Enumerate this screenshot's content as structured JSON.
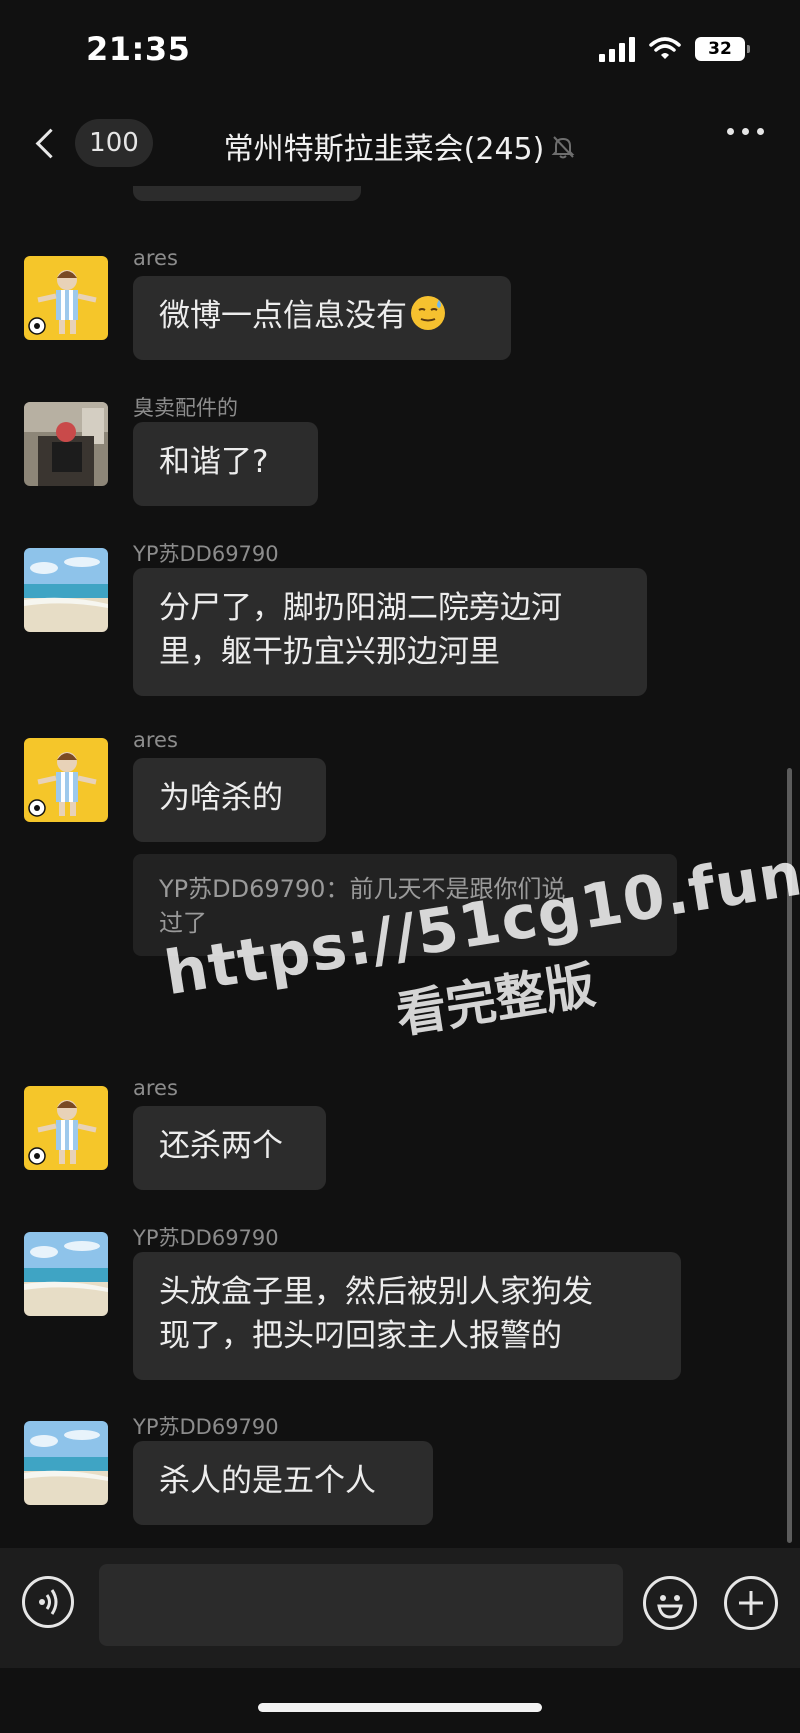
{
  "status_bar": {
    "time": "21:35",
    "battery": "32"
  },
  "nav": {
    "unread_count": "100",
    "title": "常州特斯拉韭菜会(245)"
  },
  "icons": {
    "back": "chevron-left-icon",
    "mute": "bell-slash-icon",
    "more": "more-dots-icon",
    "voice": "voice-icon",
    "emoji": "emoji-icon",
    "plus": "plus-icon"
  },
  "messages": [
    {
      "sender": "ares",
      "avatar": "avatar-cartoon-footballer",
      "text": "微博一点信息没有",
      "emoji": "sweat-smile-emoji"
    },
    {
      "sender": "臭卖配件的",
      "avatar": "avatar-room-photo",
      "text": "和谐了?"
    },
    {
      "sender": "YP苏DD69790",
      "avatar": "avatar-beach-photo",
      "text_lines": [
        "分尸了，脚扔阳湖二院旁边河",
        "里，躯干扔宜兴那边河里"
      ]
    },
    {
      "sender": "ares",
      "avatar": "avatar-cartoon-footballer",
      "text": "为啥杀的",
      "quote_lines": [
        "YP苏DD69790：前几天不是跟你们说",
        "过了"
      ]
    },
    {
      "sender": "ares",
      "avatar": "avatar-cartoon-footballer",
      "text": "还杀两个"
    },
    {
      "sender": "YP苏DD69790",
      "avatar": "avatar-beach-photo",
      "text_lines": [
        "头放盒子里，然后被别人家狗发",
        "现了，把头叼回家主人报警的"
      ]
    },
    {
      "sender": "YP苏DD69790",
      "avatar": "avatar-beach-photo",
      "text": "杀人的是五个人"
    }
  ],
  "watermark": {
    "url": "https://51cg10.fun",
    "subtitle": "看完整版"
  },
  "colors": {
    "background": "#111111",
    "bubble": "#2c2c2c",
    "quote": "#222222",
    "sender": "#8c8c8c"
  }
}
